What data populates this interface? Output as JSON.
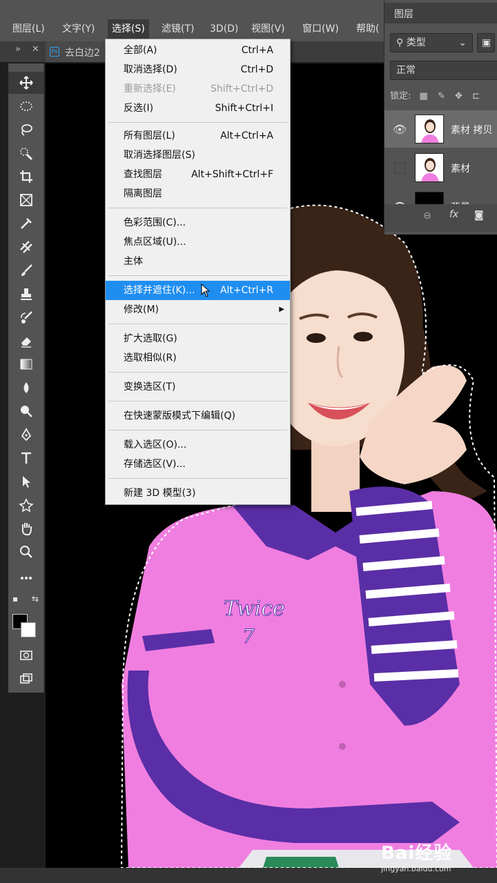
{
  "menubar": {
    "items": [
      "图层(L)",
      "文字(Y)",
      "选择(S)",
      "滤镜(T)",
      "3D(D)",
      "视图(V)",
      "窗口(W)",
      "帮助("
    ]
  },
  "tab": {
    "title": "去白边2"
  },
  "select_menu": {
    "groups": [
      [
        {
          "label": "全部(A)",
          "shortcut": "Ctrl+A"
        },
        {
          "label": "取消选择(D)",
          "shortcut": "Ctrl+D"
        },
        {
          "label": "重新选择(E)",
          "shortcut": "Shift+Ctrl+D",
          "disabled": true
        },
        {
          "label": "反选(I)",
          "shortcut": "Shift+Ctrl+I"
        }
      ],
      [
        {
          "label": "所有图层(L)",
          "shortcut": "Alt+Ctrl+A"
        },
        {
          "label": "取消选择图层(S)",
          "shortcut": ""
        },
        {
          "label": "查找图层",
          "shortcut": "Alt+Shift+Ctrl+F"
        },
        {
          "label": "隔离图层",
          "shortcut": ""
        }
      ],
      [
        {
          "label": "色彩范围(C)...",
          "shortcut": ""
        },
        {
          "label": "焦点区域(U)...",
          "shortcut": ""
        },
        {
          "label": "主体",
          "shortcut": ""
        }
      ],
      [
        {
          "label": "选择并遮住(K)...",
          "shortcut": "Alt+Ctrl+R",
          "highlighted": true
        },
        {
          "label": "修改(M)",
          "shortcut": "",
          "submenu": true
        }
      ],
      [
        {
          "label": "扩大选取(G)",
          "shortcut": ""
        },
        {
          "label": "选取相似(R)",
          "shortcut": ""
        }
      ],
      [
        {
          "label": "变换选区(T)",
          "shortcut": ""
        }
      ],
      [
        {
          "label": "在快速蒙版模式下编辑(Q)",
          "shortcut": ""
        }
      ],
      [
        {
          "label": "载入选区(O)...",
          "shortcut": ""
        },
        {
          "label": "存储选区(V)...",
          "shortcut": ""
        }
      ],
      [
        {
          "label": "新建 3D 模型(3)",
          "shortcut": ""
        }
      ]
    ]
  },
  "layers_panel": {
    "title": "图层",
    "filter_kind": "类型",
    "blend_mode": "正常",
    "lock_label": "锁定:",
    "layers": [
      {
        "name": "素材 拷贝",
        "visible": true,
        "selected": true
      },
      {
        "name": "素材",
        "visible": false,
        "selected": false
      },
      {
        "name": "背景",
        "visible": true,
        "selected": false
      }
    ],
    "footer_fx": "fx"
  },
  "watermark": {
    "brand": "Bai经验",
    "url": "jingyan.baidu.com"
  },
  "colors": {
    "menu_highlight": "#1f8ef1",
    "shirt_pink": "#f07ee0",
    "shirt_purple": "#5a2ea6",
    "panel_bg": "#535353"
  }
}
